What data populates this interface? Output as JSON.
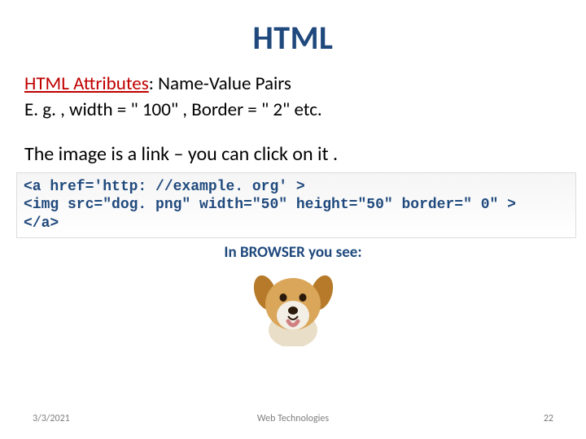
{
  "title": "HTML",
  "subtitle_prefix": "HTML Attributes",
  "subtitle_suffix": ": Name-Value Pairs",
  "example_line": "E. g. , width = \" 100\" ,  Border = \" 2\" etc.",
  "link_line": "The image is a link – you can click on it .",
  "code": {
    "l1": "<a href='http: //example. org' >",
    "l2": "<img src=\"dog. png\" width=\"50\" height=\"50\" border=\" 0\" >",
    "l3": "</a>"
  },
  "browser_label": "In BROWSER you see:",
  "image_alt": "dog image",
  "footer": {
    "date": "3/3/2021",
    "center": "Web Technologies",
    "page": "22"
  }
}
